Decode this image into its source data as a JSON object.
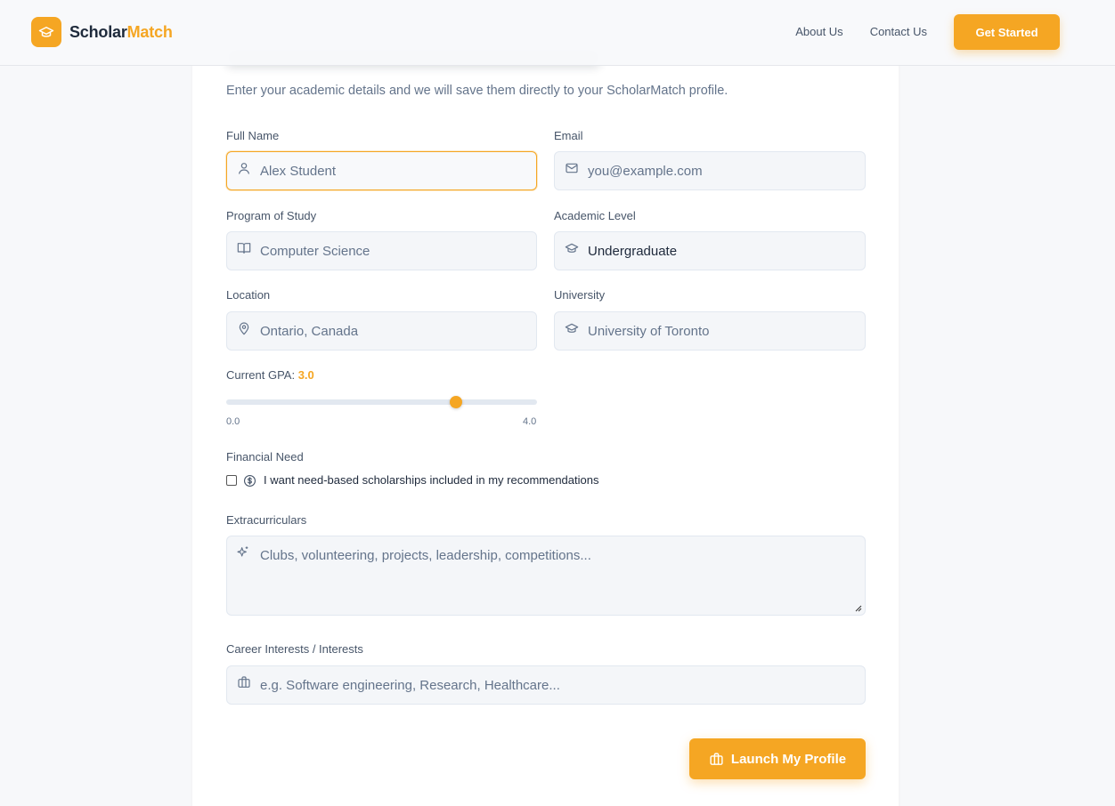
{
  "brand": {
    "name_part1": "Scholar",
    "name_part2": "Match",
    "accent": "#f5a623"
  },
  "nav": {
    "about": "About Us",
    "contact": "Contact Us",
    "cta": "Get Started"
  },
  "form": {
    "subtitle": "Enter your academic details and we will save them directly to your ScholarMatch profile.",
    "full_name": {
      "label": "Full Name",
      "value": "Alex Student"
    },
    "email": {
      "label": "Email",
      "placeholder": "you@example.com"
    },
    "program": {
      "label": "Program of Study",
      "placeholder": "Computer Science"
    },
    "academic_level": {
      "label": "Academic Level",
      "value": "Undergraduate"
    },
    "location": {
      "label": "Location",
      "placeholder": "Ontario, Canada"
    },
    "university": {
      "label": "University",
      "placeholder": "University of Toronto"
    },
    "gpa": {
      "label": "Current GPA:",
      "value": "3.0",
      "min_label": "0.0",
      "max_label": "4.0",
      "min": 0,
      "max": 4,
      "current": 3.0
    },
    "financial_need": {
      "label": "Financial Need",
      "checkbox_text": "I want need-based scholarships included in my recommendations",
      "checked": false
    },
    "extracurriculars": {
      "label": "Extracurriculars",
      "placeholder": "Clubs, volunteering, projects, leadership, competitions..."
    },
    "career_interests": {
      "label": "Career Interests / Interests",
      "placeholder": "e.g. Software engineering, Research, Healthcare..."
    },
    "submit": "Launch My Profile"
  }
}
